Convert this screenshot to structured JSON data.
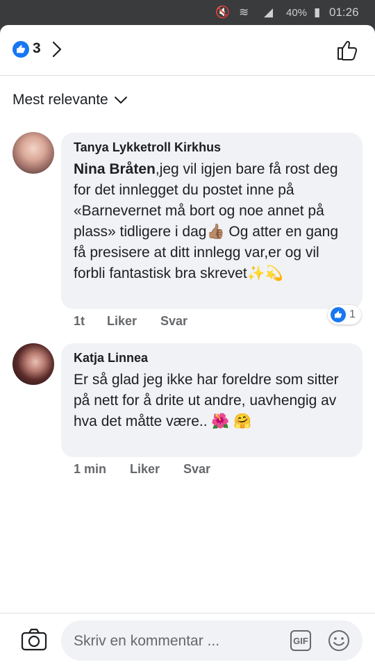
{
  "status_bar": {
    "battery": "40%",
    "time": "01:26"
  },
  "header": {
    "like_count": "3"
  },
  "sort": {
    "label": "Mest relevante"
  },
  "comments": [
    {
      "author": "Tanya Lykketroll Kirkhus",
      "mention": "Nina Bråten",
      "text": ",jeg vil igjen bare få rost deg for det innlegget du postet inne på «Barnevernet må bort og noe annet på plass» tidligere i dag👍🏽 Og atter en gang få presisere at ditt innlegg var,er og vil forbli fantastisk bra skrevet✨💫",
      "time": "1t",
      "like_label": "Liker",
      "reply_label": "Svar",
      "reaction_count": "1"
    },
    {
      "author": "Katja Linnea",
      "text": "Er så glad jeg ikke har foreldre som sitter på nett for å drite ut andre, uavhengig av hva det måtte være.. 🌺 🤗",
      "time": "1 min",
      "like_label": "Liker",
      "reply_label": "Svar"
    }
  ],
  "composer": {
    "placeholder": "Skriv en kommentar ...",
    "gif_label": "GIF"
  },
  "colors": {
    "brand_blue": "#1877f2",
    "bubble_bg": "#f0f2f5",
    "meta_gray": "#65676b"
  },
  "icons": [
    "camera-icon",
    "gif-icon",
    "emoji-icon",
    "thumbs-up-icon",
    "chevron-right-icon",
    "chevron-down-icon"
  ]
}
